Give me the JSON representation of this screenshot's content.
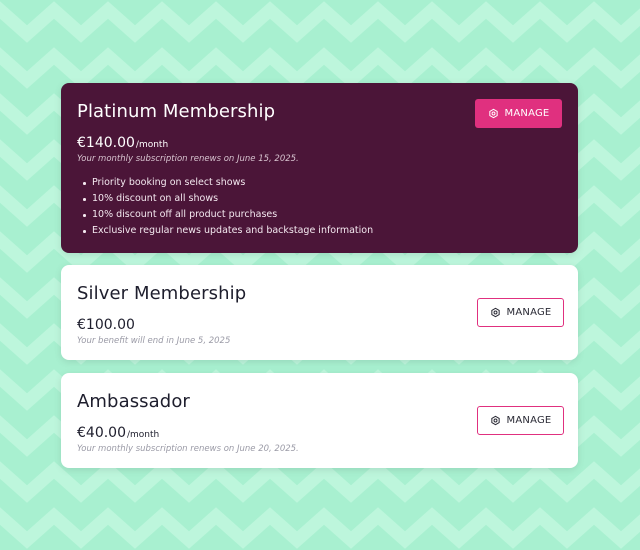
{
  "colors": {
    "background": "#a8f0d0",
    "chevron": "#b9f4d9",
    "platinum_card": "#4b1538",
    "accent": "#e0307f"
  },
  "plans": [
    {
      "title": "Platinum Membership",
      "price": "€140.00",
      "period": "/month",
      "note": "Your monthly subscription renews on June 15, 2025.",
      "benefits": [
        "Priority booking on select shows",
        "10% discount on all shows",
        "10% discount off all product purchases",
        "Exclusive regular news updates and backstage information"
      ],
      "button_label": "MANAGE",
      "button_icon": "gear-icon"
    },
    {
      "title": "Silver Membership",
      "price": "€100.00",
      "period": "",
      "note": "Your benefit will end in June 5, 2025",
      "button_label": "MANAGE",
      "button_icon": "gear-icon"
    },
    {
      "title": "Ambassador",
      "price": "€40.00",
      "period": "/month",
      "note": "Your monthly subscription renews on June 20, 2025.",
      "button_label": "MANAGE",
      "button_icon": "gear-icon"
    }
  ]
}
